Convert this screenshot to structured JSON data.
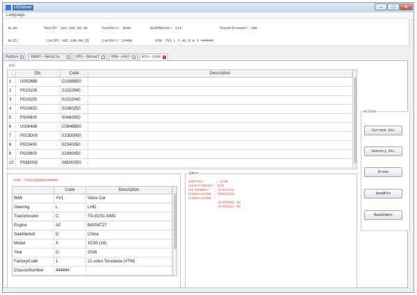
{
  "window": {
    "title": "UDSolver",
    "menu": "Language",
    "controls": {
      "minimize": "–",
      "maximize": "□",
      "close": "✕"
    }
  },
  "info": {
    "kl30": "KL30:",
    "testip": "TestIP: 192.168.88.96",
    "testport": "TestPort: 3849",
    "doipmaster": "DoIPMaster: 114",
    "testerpresent": "TesterPresent: 266",
    "kl15": "KL15:",
    "carip": "CarIP: 192.168.88.55",
    "carport": "CarPort: 13400",
    "vin": "VIN: YV1 L C A2 D G 1 444844"
  },
  "tabs": [
    {
      "label": "PubSys"
    },
    {
      "label": "IDENT--Details"
    },
    {
      "label": "DTC--Detail"
    },
    {
      "label": "VIN--1417"
    },
    {
      "label": "ECU--1630"
    }
  ],
  "dtc": {
    "section": "DTC",
    "columns": [
      "",
      "Dtc",
      "Code",
      "Description"
    ],
    "rows": [
      {
        "n": "1",
        "dtc": "U002888",
        "code": "C0288850"
      },
      {
        "n": "2",
        "dtc": "P010109",
        "code": "01010940"
      },
      {
        "n": "3",
        "dtc": "P010100",
        "code": "01010040"
      },
      {
        "n": "4",
        "dtc": "P010602",
        "code": "01060250"
      },
      {
        "n": "5",
        "dtc": "P004800",
        "code": "00480050"
      },
      {
        "n": "6",
        "dtc": "U006488",
        "code": "C0648850"
      },
      {
        "n": "7",
        "dtc": "P023D00",
        "code": "023D0050"
      },
      {
        "n": "8",
        "dtc": "P023400",
        "code": "02340050"
      },
      {
        "n": "9",
        "dtc": "P029900",
        "code": "02990050"
      },
      {
        "n": "10",
        "dtc": "P06D000",
        "code": "06D00050"
      }
    ]
  },
  "action": {
    "label": "Action",
    "buttons": [
      "Current Dtc",
      "History Dtc",
      "Erase",
      "ReadPin",
      "ReadIdent"
    ]
  },
  "vin_panel": {
    "title": "VIN: YV1LCA2DG1444844",
    "columns": [
      "",
      "Code",
      "Description"
    ],
    "rows": [
      {
        "field": "WMI",
        "code": "YV1",
        "desc": "Volov Car"
      },
      {
        "field": "Steering",
        "code": "L",
        "desc": "LHD"
      },
      {
        "field": "Transmission",
        "code": "C",
        "desc": "TG-81SC AWD"
      },
      {
        "field": "Engine",
        "code": "A2",
        "desc": "B4204T27"
      },
      {
        "field": "SaleMarket",
        "code": "D",
        "desc": "China"
      },
      {
        "field": "Model",
        "code": "X",
        "desc": "XC90 (16)"
      },
      {
        "field": "Year",
        "code": "G",
        "desc": "2016"
      },
      {
        "field": "FactoryCode",
        "code": "1",
        "desc": "21 volvo Torslanda (VTM)"
      },
      {
        "field": "ChassisNumber",
        "code": "444844",
        "desc": ""
      }
    ]
  },
  "ident": {
    "title": "Ident",
    "lines": [
      "Address      : 1630",
      "ControlModel: ECM",
      "PartNumber  : 31452223",
      "H/WSerialNO : 00002A1A",
      "S/WSerialNO :",
      "              31459848 AA",
      "              31459293 AD"
    ]
  }
}
